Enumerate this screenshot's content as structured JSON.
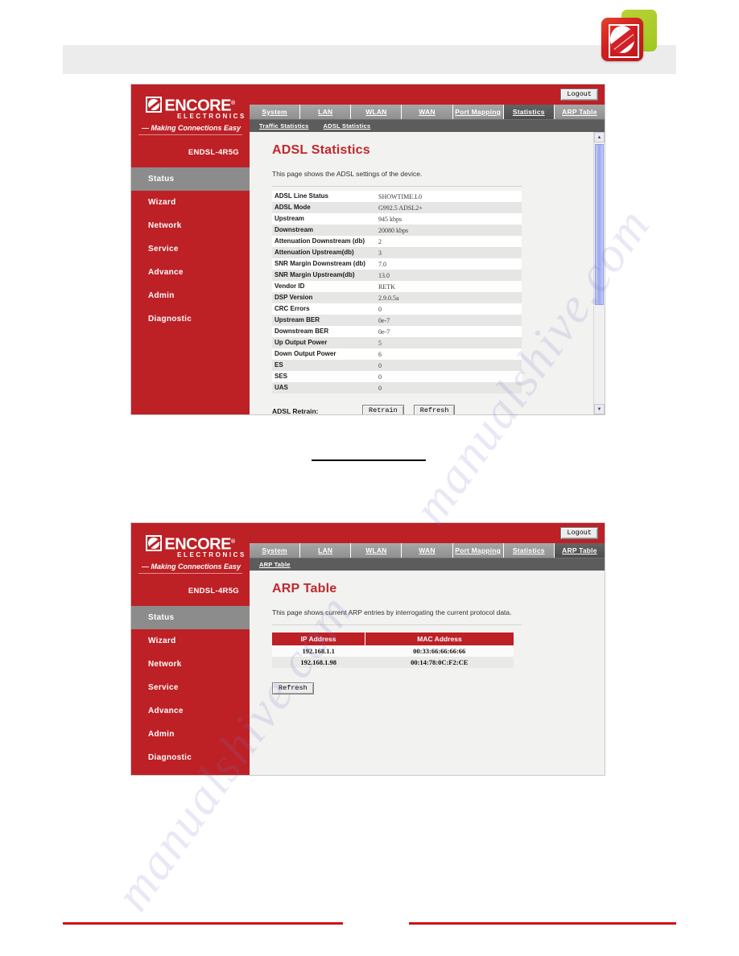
{
  "document": {
    "watermark": "manualshive.com"
  },
  "brand": {
    "logo_name": "encore-logo",
    "accent_red": "#BD2025",
    "accent_green": "#A8C82A"
  },
  "router_ui": {
    "sidebar": {
      "logo_word": "ENCORE",
      "logo_reg": "®",
      "logo_sub": "ELECTRONICS",
      "tagline": "— Making Connections Easy",
      "model": "ENDSL-4R5G",
      "items": [
        {
          "label": "Status",
          "active": true
        },
        {
          "label": "Wizard",
          "active": false
        },
        {
          "label": "Network",
          "active": false
        },
        {
          "label": "Service",
          "active": false
        },
        {
          "label": "Advance",
          "active": false
        },
        {
          "label": "Admin",
          "active": false
        },
        {
          "label": "Diagnostic",
          "active": false
        }
      ]
    },
    "topbar": {
      "logout_label": "Logout"
    },
    "tabs": [
      {
        "label": "System"
      },
      {
        "label": "LAN"
      },
      {
        "label": "WLAN"
      },
      {
        "label": "WAN"
      },
      {
        "label": "Port Mapping"
      },
      {
        "label": "Statistics"
      },
      {
        "label": "ARP Table"
      }
    ]
  },
  "screenshot_adsl": {
    "active_tab": "Statistics",
    "subtabs": [
      {
        "label": "Traffic Statistics"
      },
      {
        "label": "ADSL Statistics"
      }
    ],
    "title": "ADSL Statistics",
    "description": "This page shows the ADSL settings of the device.",
    "rows": [
      {
        "key": "ADSL Line Status",
        "value": "SHOWTIME.L0"
      },
      {
        "key": "ADSL Mode",
        "value": "G992.5 ADSL2+"
      },
      {
        "key": "Upstream",
        "value": "945 kbps"
      },
      {
        "key": "Downstream",
        "value": "20080 kbps"
      },
      {
        "key": "Attenuation Downstream (db)",
        "value": "2"
      },
      {
        "key": "Attenuation Upstream(db)",
        "value": "3"
      },
      {
        "key": "SNR Margin Downstream (db)",
        "value": "7.0"
      },
      {
        "key": "SNR Margin Upstream(db)",
        "value": "13.0"
      },
      {
        "key": "Vendor ID",
        "value": "RETK"
      },
      {
        "key": "DSP Version",
        "value": "2.9.0.5a"
      },
      {
        "key": "CRC Errors",
        "value": "0"
      },
      {
        "key": "Upstream BER",
        "value": "0e-7"
      },
      {
        "key": "Downstream BER",
        "value": "0e-7"
      },
      {
        "key": "Up Output Power",
        "value": "5"
      },
      {
        "key": "Down Output Power",
        "value": "6"
      },
      {
        "key": "ES",
        "value": "0"
      },
      {
        "key": "SES",
        "value": "0"
      },
      {
        "key": "UAS",
        "value": "0"
      }
    ],
    "retrain_label": "ADSL Retrain:",
    "retrain_button": "Retrain",
    "refresh_button": "Refresh"
  },
  "screenshot_arp": {
    "active_tab": "ARP Table",
    "subtabs": [
      {
        "label": "ARP Table"
      }
    ],
    "title": "ARP Table",
    "description": "This page shows current ARP entries by interrogating the current protocol data.",
    "columns": [
      "IP Address",
      "MAC Address"
    ],
    "entries": [
      {
        "ip": "192.168.1.1",
        "mac": "00:33:66:66:66:66"
      },
      {
        "ip": "192.168.1.98",
        "mac": "00:14:78:0C:F2:CE"
      }
    ],
    "refresh_button": "Refresh"
  }
}
